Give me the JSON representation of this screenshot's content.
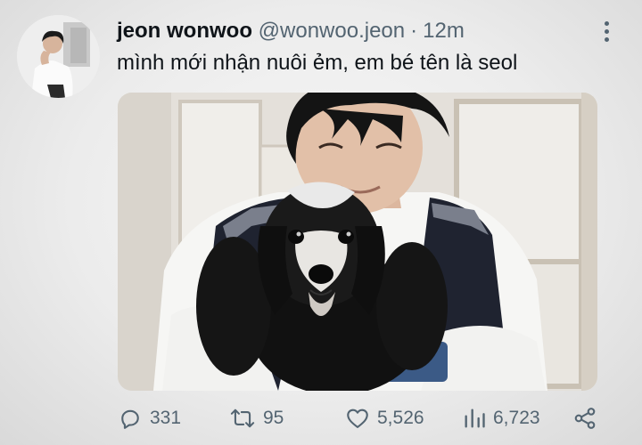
{
  "tweet": {
    "author_name": "jeon wonwoo",
    "author_handle": "@wonwoo.jeon",
    "separator": "·",
    "time_ago": "12m",
    "text": "mình mới nhận nuôi ẻm, em bé tên là seol",
    "more_icon": "more-vertical-icon",
    "avatar": "profile-photo",
    "media": "photo-man-holding-dog"
  },
  "actions": {
    "replies": "331",
    "retweets": "95",
    "likes": "5,526",
    "views": "6,723",
    "reply_icon": "reply-icon",
    "retweet_icon": "retweet-icon",
    "like_icon": "heart-icon",
    "views_icon": "views-bar-chart-icon",
    "share_icon": "share-icon"
  },
  "colors": {
    "text_primary": "#0f1419",
    "text_secondary": "#536471"
  }
}
